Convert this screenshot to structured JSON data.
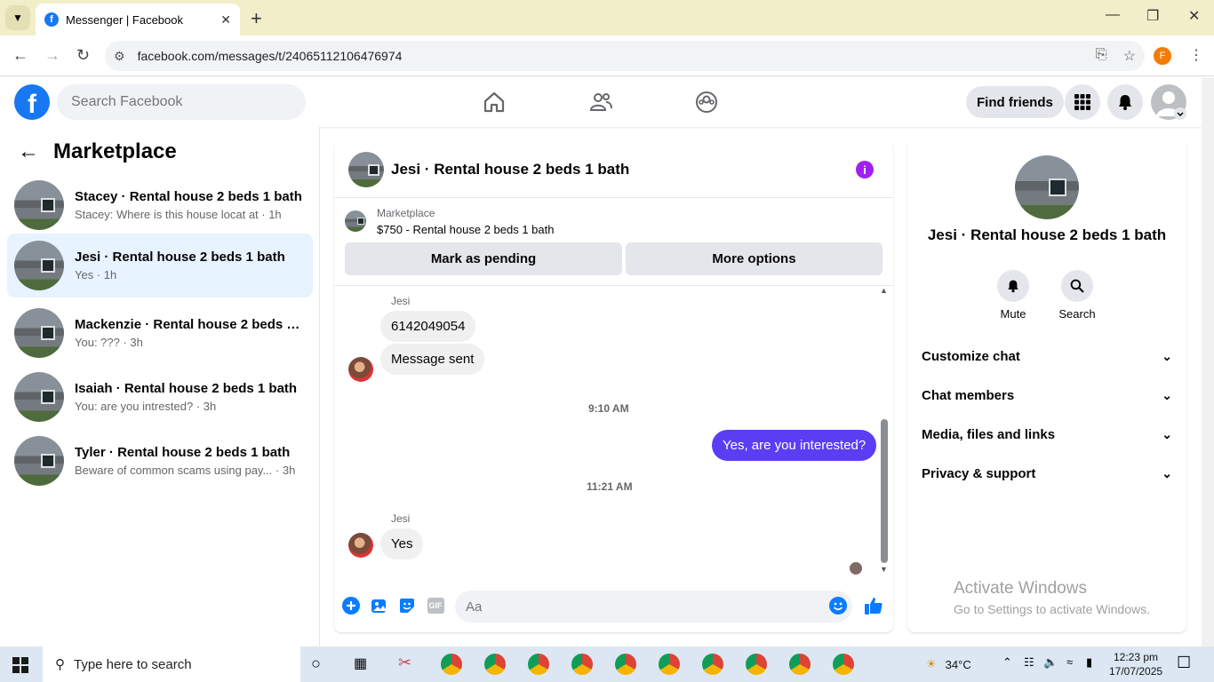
{
  "browser": {
    "tab_title": "Messenger | Facebook",
    "url": "facebook.com/messages/t/24065112106476974",
    "profile_initial": "F"
  },
  "fb_header": {
    "search_placeholder": "Search Facebook",
    "find_friends": "Find friends"
  },
  "left_panel": {
    "title": "Marketplace",
    "conversations": [
      {
        "name": "Stacey · Rental house 2 beds 1 bath",
        "preview": "Stacey: Where is this house locat at · 1h",
        "active": false
      },
      {
        "name": "Jesi · Rental house 2 beds 1 bath",
        "preview": "Yes · 1h",
        "active": true
      },
      {
        "name": "Mackenzie · Rental house 2 beds 1 ...",
        "preview": "You: ??? · 3h",
        "active": false
      },
      {
        "name": "Isaiah · Rental house 2 beds 1 bath",
        "preview": "You: are you intrested? · 3h",
        "active": false
      },
      {
        "name": "Tyler · Rental house 2 beds 1 bath",
        "preview": "Beware of common scams using pay...   · 3h",
        "active": false
      }
    ]
  },
  "chat": {
    "title": "Jesi · Rental house 2 beds 1 bath",
    "marketplace_label": "Marketplace",
    "listing": "$750 - Rental house 2 beds 1 bath",
    "mark_pending": "Mark as pending",
    "more_options": "More options",
    "messages": {
      "sender1": "Jesi",
      "msg1": "6142049054",
      "msg2": "Message sent",
      "time1": "9:10 AM",
      "out1": "Yes, are you interested?",
      "time2": "11:21 AM",
      "sender2": "Jesi",
      "msg3": "Yes"
    },
    "composer_placeholder": "Aa",
    "gif_label": "GIF"
  },
  "right_panel": {
    "name": "Jesi · Rental house 2 beds 1 bath",
    "mute": "Mute",
    "search": "Search",
    "items": [
      "Customize chat",
      "Chat members",
      "Media, files and links",
      "Privacy & support"
    ]
  },
  "watermark": {
    "line1": "Activate Windows",
    "line2": "Go to Settings to activate Windows."
  },
  "taskbar": {
    "search_placeholder": "Type here to search",
    "temperature": "34°C",
    "time": "12:23 pm",
    "date": "17/07/2025"
  },
  "colors": {
    "facebook_blue": "#1877f2",
    "outgoing_bubble": "#5b3ef4",
    "active_convo": "#e7f3ff"
  }
}
